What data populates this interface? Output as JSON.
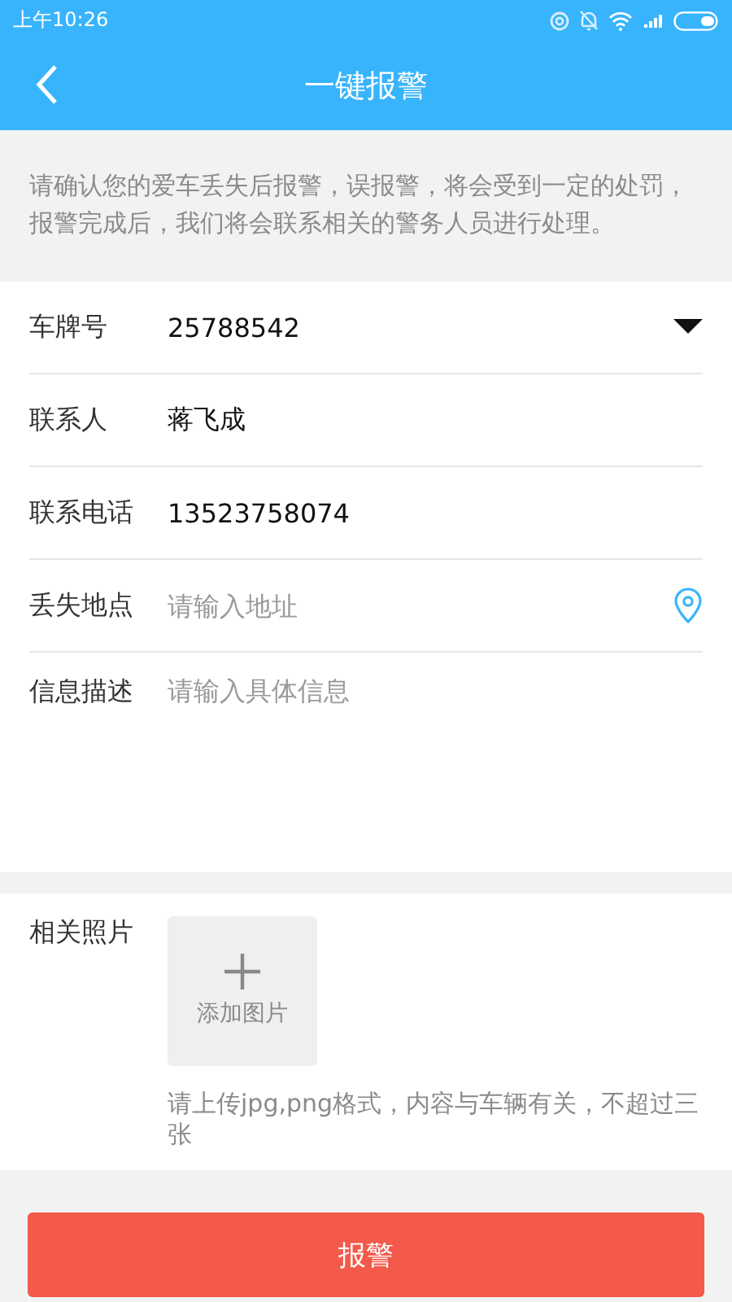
{
  "status_bar": {
    "time": "上午10:26"
  },
  "header": {
    "title": "一键报警"
  },
  "notice": "请确认您的爱车丢失后报警，误报警，将会受到一定的处罚，报警完成后，我们将会联系相关的警务人员进行处理。",
  "fields": [
    {
      "kind": "select",
      "label": "车牌号",
      "value": "25788542"
    },
    {
      "kind": "text",
      "label": "联系人",
      "value": "蒋飞成"
    },
    {
      "kind": "text",
      "label": "联系电话",
      "value": "13523758074"
    },
    {
      "kind": "location",
      "label": "丢失地点",
      "placeholder": "请输入地址"
    },
    {
      "kind": "textarea",
      "label": "信息描述",
      "placeholder": "请输入具体信息"
    }
  ],
  "photos": {
    "label": "相关照片",
    "add_label": "添加图片",
    "hint": "请上传jpg,png格式，内容与车辆有关，不超过三张"
  },
  "submit": "报警"
}
